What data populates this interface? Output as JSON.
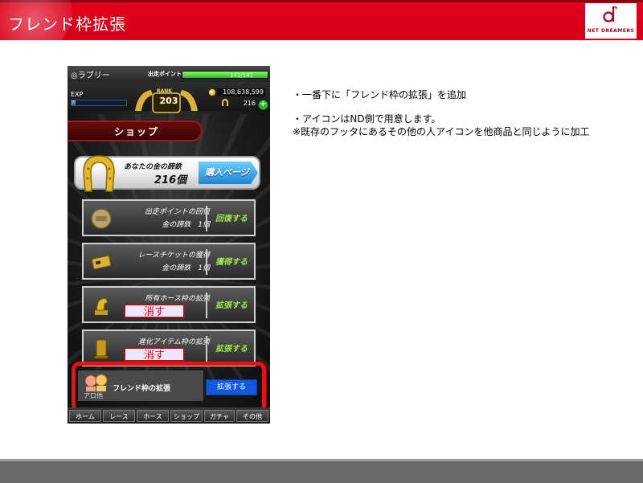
{
  "slide": {
    "title": "フレンド枠拡張",
    "logo_text": "NET DREAMERS",
    "accent": "#e1001e"
  },
  "notes": [
    "・一番下に「フレンド枠の拡張」を追加",
    "・アイコンはND側で用意します。",
    "※既存のフッタにあるその他の人アイコンを他商品と同じように加工"
  ],
  "phone": {
    "username": "◎ラブリー",
    "sp_label": "出走ポイント",
    "sp_value": "141/141",
    "sp_fraction": 1.0,
    "exp_label": "EXP",
    "exp_fraction": 0.08,
    "rank_label": "RANK",
    "rank_value": "203",
    "money": "108,638,599",
    "horseshoes": "216",
    "plus_label": "+",
    "shop_title": "ショップ",
    "gold": {
      "label": "あなたの金の蹄鉄",
      "count": "216個",
      "button": "購入ページ"
    },
    "items": [
      {
        "name": "出走ポイントの回復",
        "cost": "金の蹄鉄　1個",
        "action": "回復する",
        "icon": "medal-icon"
      },
      {
        "name": "レースチケットの獲得",
        "cost": "金の蹄鉄　1個",
        "action": "獲得する",
        "icon": "ticket-icon"
      },
      {
        "name": "所有ホース枠の拡張",
        "cost": "",
        "action": "拡張する",
        "erase": "消す",
        "icon": "horse-trophy-icon"
      },
      {
        "name": "進化アイテム枠の拡張",
        "cost": "",
        "action": "拡張する",
        "erase": "消す",
        "icon": "item-box-icon"
      }
    ],
    "friend": {
      "label": "フレンド枠の拡張",
      "sub": "ア口他",
      "button": "拡張する"
    },
    "nav": [
      "ホーム",
      "レース",
      "ホース",
      "ショップ",
      "ガチャ",
      "その他"
    ]
  }
}
